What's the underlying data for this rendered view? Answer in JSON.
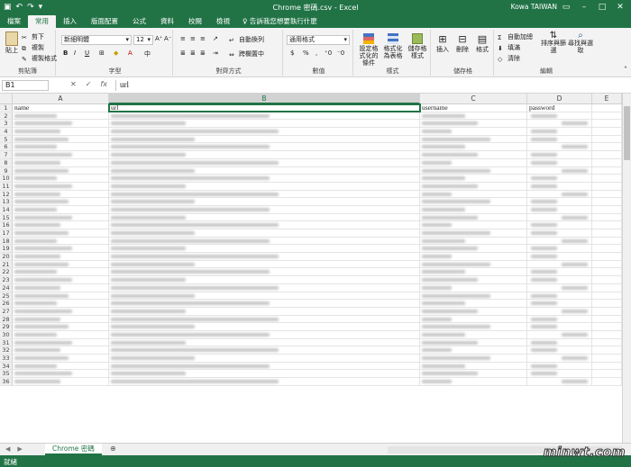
{
  "qat": {
    "save_icon": "save-icon",
    "undo_icon": "undo-icon",
    "redo_icon": "redo-icon"
  },
  "window": {
    "title": "Chrome 密碼.csv - Excel",
    "user": "Kowa TAIWAN"
  },
  "tabs": [
    "檔案",
    "常用",
    "插入",
    "版面配置",
    "公式",
    "資料",
    "校閱",
    "檢視"
  ],
  "tell_me": "告訴我您想要執行什麼",
  "ribbon": {
    "clipboard": {
      "label": "剪貼簿",
      "paste": "貼上",
      "cut": "剪下",
      "copy": "複製",
      "format_painter": "複製格式"
    },
    "font": {
      "label": "字型",
      "font_name": "新細明體",
      "font_size": "12",
      "bold": "B",
      "italic": "I",
      "underline": "U"
    },
    "alignment": {
      "label": "對齊方式",
      "wrap": "自動換列",
      "merge": "跨欄置中"
    },
    "number": {
      "label": "數值",
      "format": "通用格式",
      "currency": "$",
      "percent": "%",
      "comma": ","
    },
    "styles": {
      "label": "樣式",
      "conditional": "設定格式化的條件",
      "format_table": "格式化為表格",
      "cell_styles": "儲存格樣式"
    },
    "cells": {
      "label": "儲存格",
      "insert": "插入",
      "delete": "刪除",
      "format": "格式"
    },
    "editing": {
      "label": "編輯",
      "autosum": "自動加總",
      "fill": "填滿",
      "clear": "清除",
      "sort": "排序與篩選",
      "find": "尋找與選取"
    }
  },
  "formula_bar": {
    "name_box": "B1",
    "value": "url",
    "fx": "fx"
  },
  "columns": [
    "A",
    "B",
    "C",
    "D",
    "E"
  ],
  "rows": {
    "headers": [
      "name",
      "url",
      "username",
      "password"
    ],
    "count": 36
  },
  "sheet": {
    "tab": "Chrome 密碼"
  },
  "status": "就緒",
  "watermark": "minwt.com"
}
